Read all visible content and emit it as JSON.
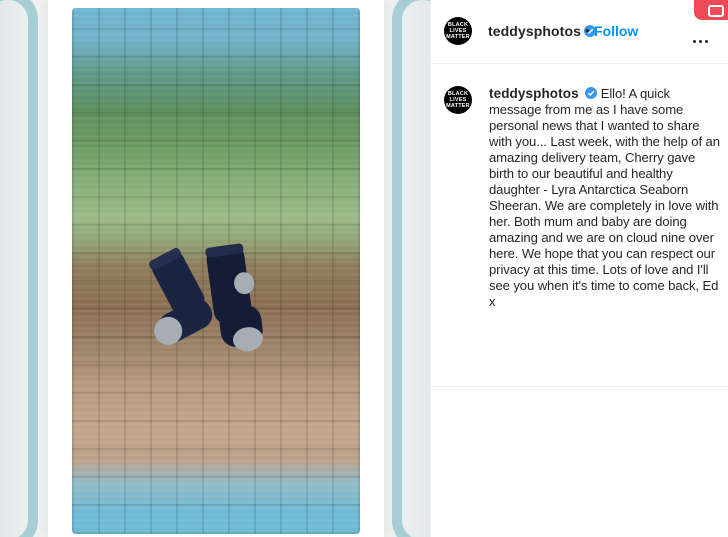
{
  "post": {
    "username": "teddysphotos",
    "follow_label": "Follow",
    "separator": "•",
    "avatar_text": [
      "BLACK",
      "LIVES",
      "MATTER"
    ],
    "caption": "Ello! A quick message from me as I have some personal news that I wanted to share with you... Last week, with the help of an amazing delivery team, Cherry gave birth to our beautiful and healthy daughter - Lyra Antarctica Seaborn Sheeran. We are completely in love with her. Both mum and baby are doing amazing and we are on cloud nine over here. We hope that you can respect our privacy at this time. Lots of love and I'll see you when it's time to come back, Ed x"
  },
  "icons": {
    "verified": "verified-badge-icon",
    "more": "more-options-icon"
  },
  "colors": {
    "follow": "#0095f6",
    "verified": "#3897f0",
    "text": "#262626",
    "accent_tab": "#ed4956"
  }
}
